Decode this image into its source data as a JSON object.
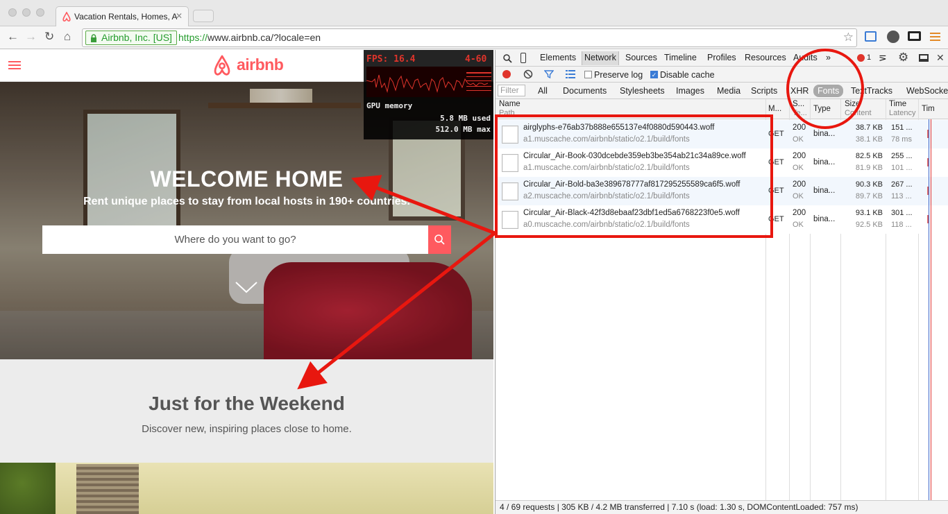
{
  "browser": {
    "tab_title": "Vacation Rentals, Homes, A",
    "ev_label": "Airbnb, Inc. [US]",
    "url_scheme": "https://",
    "url_rest": "www.airbnb.ca/?locale=en"
  },
  "site": {
    "brand": "airbnb",
    "hero_title": "WELCOME HOME",
    "hero_subtitle": "Rent unique places to stay from local hosts in 190+ countries.",
    "search_placeholder": "Where do you want to go?",
    "section_title": "Just for the Weekend",
    "section_subtitle": "Discover new, inspiring places close to home.",
    "accent_color": "#ff5a5f"
  },
  "fps_meter": {
    "fps": "FPS: 16.4",
    "range": "4-60",
    "gpu_label": "GPU memory",
    "gpu_used": "5.8 MB used",
    "gpu_max": "512.0 MB max"
  },
  "devtools": {
    "tabs": [
      "Elements",
      "Network",
      "Sources",
      "Timeline",
      "Profiles",
      "Resources",
      "Audits",
      "»"
    ],
    "error_count": "1",
    "preserve_log": "Preserve log",
    "disable_cache": "Disable cache",
    "filter_placeholder": "Filter",
    "filter_types": [
      "All",
      "Documents",
      "Stylesheets",
      "Images",
      "Media",
      "Scripts",
      "XHR",
      "Fonts",
      "TextTracks",
      "WebSockets"
    ],
    "columns": {
      "name": "Name",
      "path": "Path",
      "method": "M...",
      "status": "S...",
      "status_sub": "Te...",
      "type": "Type",
      "size": "Size",
      "content": "Content",
      "time": "Time",
      "latency": "Latency",
      "timeline": "Tim"
    },
    "rows": [
      {
        "name": "airglyphs-e76ab37b888e655137e4f0880d590443.woff",
        "path": "a1.muscache.com/airbnb/static/o2.1/build/fonts",
        "method": "GET",
        "status": "200",
        "status_text": "OK",
        "type": "bina...",
        "size": "38.7 KB",
        "content": "38.1 KB",
        "time": "151 ...",
        "latency": "78 ms"
      },
      {
        "name": "Circular_Air-Book-030dcebde359eb3be354ab21c34a89ce.woff",
        "path": "a1.muscache.com/airbnb/static/o2.1/build/fonts",
        "method": "GET",
        "status": "200",
        "status_text": "OK",
        "type": "bina...",
        "size": "82.5 KB",
        "content": "81.9 KB",
        "time": "255 ...",
        "latency": "101 ..."
      },
      {
        "name": "Circular_Air-Bold-ba3e389678777af817295255589ca6f5.woff",
        "path": "a2.muscache.com/airbnb/static/o2.1/build/fonts",
        "method": "GET",
        "status": "200",
        "status_text": "OK",
        "type": "bina...",
        "size": "90.3 KB",
        "content": "89.7 KB",
        "time": "267 ...",
        "latency": "113 ..."
      },
      {
        "name": "Circular_Air-Black-42f3d8ebaaf23dbf1ed5a6768223f0e5.woff",
        "path": "a0.muscache.com/airbnb/static/o2.1/build/fonts",
        "method": "GET",
        "status": "200",
        "status_text": "OK",
        "type": "bina...",
        "size": "93.1 KB",
        "content": "92.5 KB",
        "time": "301 ...",
        "latency": "118 ..."
      }
    ],
    "status_bar": "4 / 69 requests | 305 KB / 4.2 MB transferred | 7.10 s (load: 1.30 s, DOMContentLoaded: 757 ms)"
  }
}
